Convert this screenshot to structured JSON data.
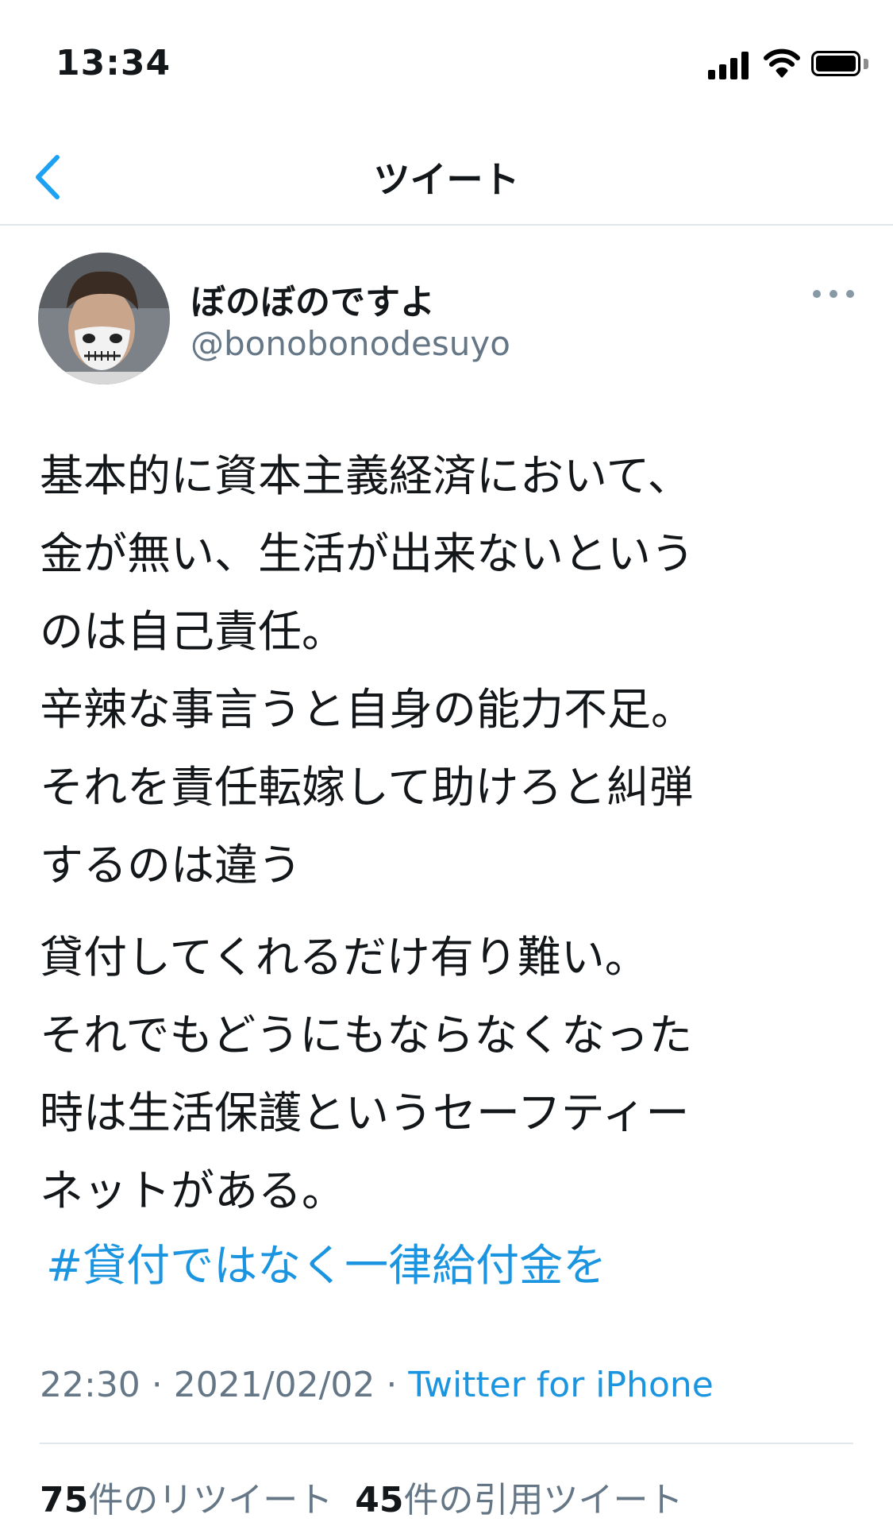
{
  "status_bar": {
    "time": "13:34"
  },
  "nav": {
    "title": "ツイート"
  },
  "author": {
    "display_name": "ぼのぼのですよ",
    "handle": "@bonobonodesuyo"
  },
  "tweet": {
    "paragraph1": [
      "基本的に資本主義経済において、",
      "金が無い、生活が出来ないという",
      "のは自己責任。",
      "辛辣な事言うと自身の能力不足。",
      "それを責任転嫁して助けろと糾弾",
      "するのは違う"
    ],
    "paragraph2": [
      "貸付してくれるだけ有り難い。",
      "それでもどうにもならなくなった",
      "時は生活保護というセーフティー",
      "ネットがある。"
    ],
    "hashtag": "#貸付ではなく一律給付金を"
  },
  "meta": {
    "time": "22:30",
    "separator": " · ",
    "date": "2021/02/02",
    "source": "Twitter for iPhone"
  },
  "stats": {
    "retweets_count": "75",
    "retweets_label": "件のリツイート",
    "quotes_count": "45",
    "quotes_label": "件の引用ツイート"
  },
  "icons": {
    "back": "chevron-left-icon",
    "more": "more-horizontal-icon",
    "signal": "cellular-signal-icon",
    "wifi": "wifi-icon",
    "battery": "battery-icon"
  },
  "colors": {
    "link": "#1b95e0",
    "secondary_text": "#657786",
    "accent": "#1da1f2"
  }
}
